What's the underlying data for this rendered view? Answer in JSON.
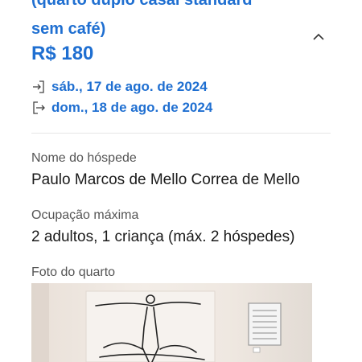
{
  "room": {
    "title_line1": "(quarto duplo casal standard",
    "title_line2": "sem café)",
    "price": "R$ 180"
  },
  "dates": {
    "checkin": "sáb., 17 de ago. de 2024",
    "checkout": "dom., 18 de ago. de 2024"
  },
  "guest": {
    "label": "Nome do hóspede",
    "value": "Paulo Marcos de Mello Correa de Mello"
  },
  "occupancy": {
    "label": "Ocupação máxima",
    "value": "2 adultos, 1 criança (máx. 2 hóspedes)"
  },
  "photo": {
    "label": "Foto do quarto"
  },
  "colors": {
    "accent": "#1f6fd1",
    "label": "#555555",
    "text": "#1a1a1a",
    "divider": "#e6e6e6"
  },
  "icons": {
    "collapse": "chevron-up-icon",
    "checkin": "checkin-arrow-icon",
    "checkout": "checkout-arrow-icon"
  }
}
